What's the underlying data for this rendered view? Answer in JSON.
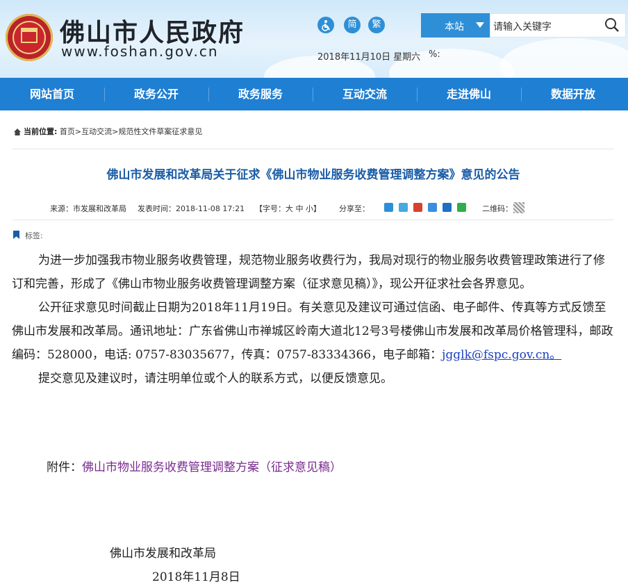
{
  "header": {
    "site_title": "佛山市人民政府",
    "site_url": "www.foshan.gov.cn",
    "accessibility_icon": "wheelchair-icon",
    "simplified_label": "简",
    "traditional_label": "繁",
    "date": "2018年11月10日 星期六",
    "weather": "%:",
    "search_scope": "本站",
    "search_placeholder": "请输入关键字",
    "search_icon": "search-icon"
  },
  "nav": {
    "items": [
      "网站首页",
      "政务公开",
      "政务服务",
      "互动交流",
      "走进佛山",
      "数据开放"
    ]
  },
  "breadcrumb": {
    "label": "当前位置:",
    "path": "首页>互动交流>规范性文件草案征求意见"
  },
  "article": {
    "title": "佛山市发展和改革局关于征求《佛山市物业服务收费管理调整方案》意见的公告",
    "source": "来源：市发展和改革局",
    "publish_time": "发表时间：2018-11-08 17:21",
    "font_size_label": "【字号：大  中  小】",
    "share_label": "分享至：",
    "qrcode_label": "二维码：",
    "tag_label": "标签:",
    "paragraphs": {
      "p1": "为进一步加强我市物业服务收费管理，规范物业服务收费行为，我局对现行的物业服务收费管理政策进行了修订和完善，形成了《佛山市物业服务收费管理调整方案（征求意见稿）》，现公开征求社会各界意见。",
      "p2_text": "公开征求意见时间截止日期为2018年11月19日。有关意见及建议可通过信函、电子邮件、传真等方式反馈至佛山市发展和改革局。通讯地址：广东省佛山市禅城区岭南大道北12号3号楼佛山市发展和改革局价格管理科，邮政编码：528000，电话: 0757-83035677，传真：0757-83334366，电子邮箱：",
      "p2_email": "jgglk@fspc.gov.cn。",
      "p3": "提交意见及建议时，请注明单位或个人的联系方式，以便反馈意见。"
    },
    "attachment_label": "附件：",
    "attachment_link": "佛山市物业服务收费管理调整方案（征求意见稿）",
    "signer": "佛山市发展和改革局",
    "sign_date": "2018年11月8日"
  },
  "colors": {
    "nav_bg": "#1f7fd3",
    "title_blue": "#1a5ca6",
    "link_purple": "#7a2a8f"
  }
}
